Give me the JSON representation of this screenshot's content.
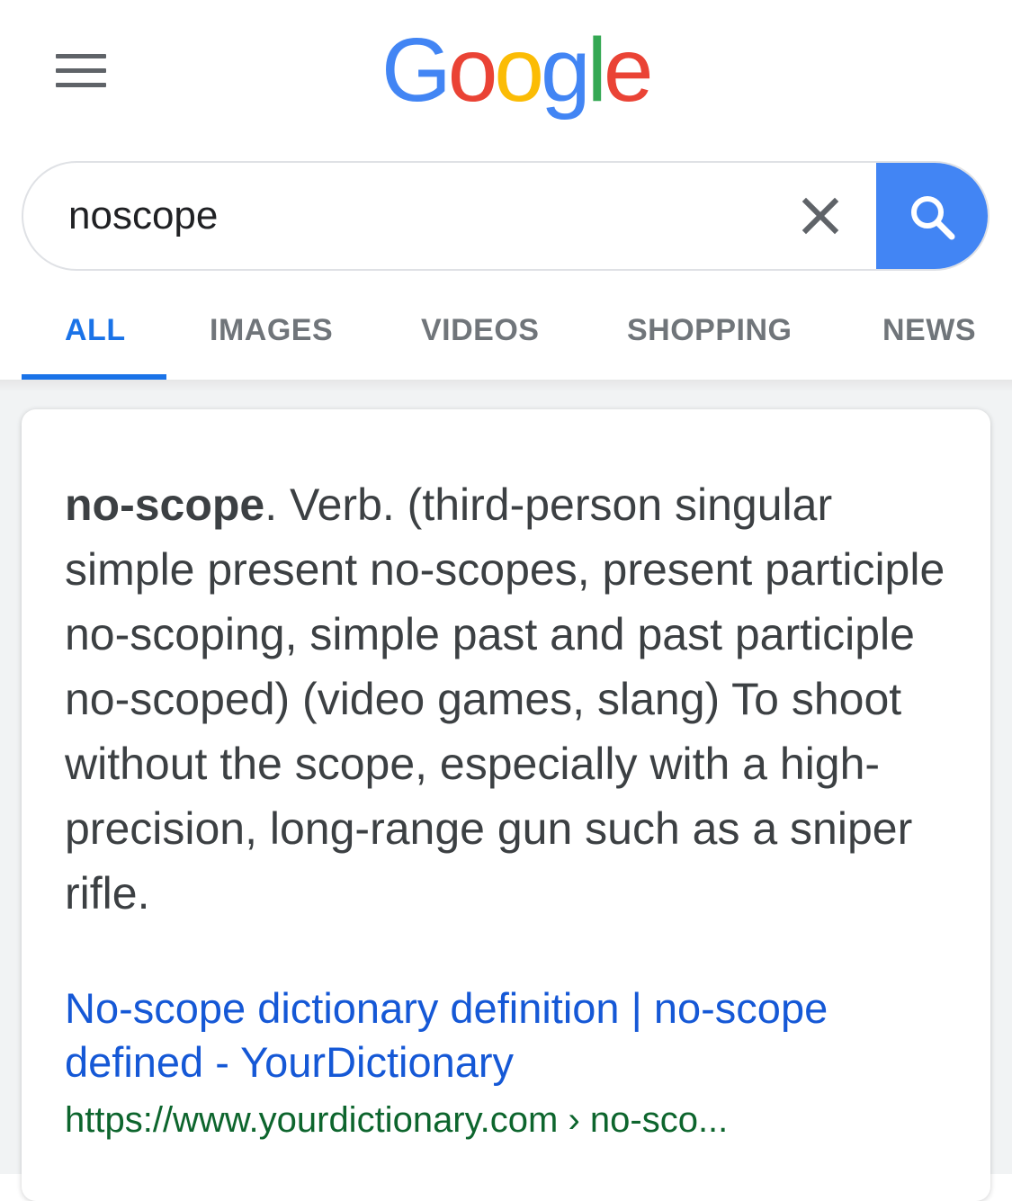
{
  "header": {
    "menu_icon": "hamburger-menu-icon",
    "logo": {
      "letters": [
        {
          "char": "G",
          "color": "#4285f4"
        },
        {
          "char": "o",
          "color": "#ea4335"
        },
        {
          "char": "o",
          "color": "#fbbc05"
        },
        {
          "char": "g",
          "color": "#4285f4"
        },
        {
          "char": "l",
          "color": "#34a853"
        },
        {
          "char": "e",
          "color": "#ea4335"
        }
      ]
    }
  },
  "search": {
    "value": "noscope",
    "clear_icon": "close-icon",
    "submit_icon": "search-icon",
    "accent_color": "#4285f4"
  },
  "tabs": [
    {
      "label": "ALL",
      "active": true
    },
    {
      "label": "IMAGES",
      "active": false
    },
    {
      "label": "VIDEOS",
      "active": false
    },
    {
      "label": "SHOPPING",
      "active": false
    },
    {
      "label": "NEWS",
      "active": false
    }
  ],
  "result": {
    "term": "no-scope",
    "definition": ". Verb. (third-person singular simple present no-scopes, present participle no-scoping, simple past and past participle no-scoped) (video games, slang) To shoot without the scope, especially with a high-precision, long-range gun such as a sniper rifle.",
    "title": "No-scope dictionary definition | no-scope defined - YourDictionary",
    "url": "https://www.yourdictionary.com › no-sco..."
  }
}
